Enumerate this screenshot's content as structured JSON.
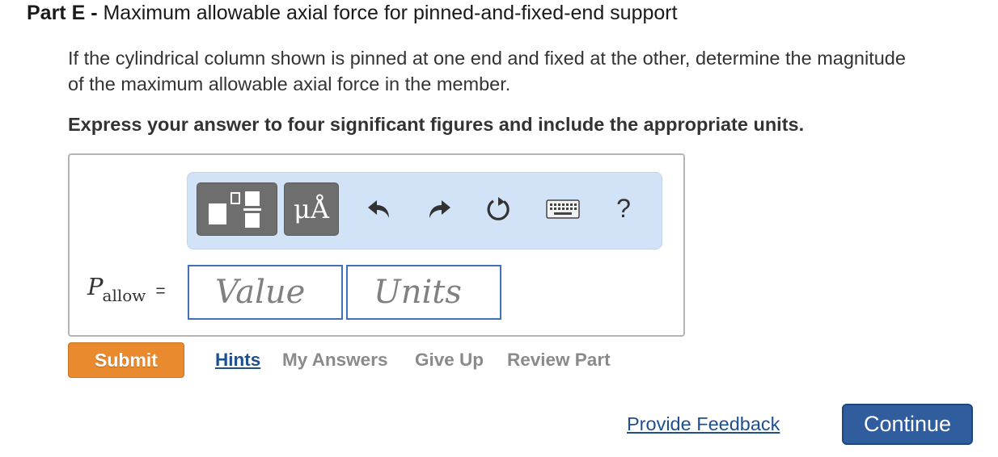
{
  "part": {
    "label": "Part E -",
    "title": "Maximum allowable axial force for pinned-and-fixed-end support"
  },
  "question": {
    "text": "If the cylindrical column shown is pinned at one end and fixed at the other, determine the magnitude of the maximum allowable axial force in the member.",
    "instruction": "Express your answer to four significant figures and include the appropriate units."
  },
  "toolbar": {
    "templates_icon": "templates-icon",
    "units_label": "μÅ",
    "undo_icon": "undo-icon",
    "redo_icon": "redo-icon",
    "reset_icon": "reset-icon",
    "keyboard_icon": "keyboard-icon",
    "help_label": "?"
  },
  "answer": {
    "variable": "P",
    "subscript": "allow",
    "equals": "=",
    "value_placeholder": "Value",
    "units_placeholder": "Units"
  },
  "actions": {
    "submit": "Submit",
    "hints": "Hints",
    "my_answers": "My Answers",
    "give_up": "Give Up",
    "review_part": "Review Part"
  },
  "footer": {
    "feedback": "Provide Feedback",
    "continue": "Continue"
  },
  "colors": {
    "submit_bg": "#ea8a2e",
    "continue_bg": "#2f5d9e",
    "link": "#1d4f91",
    "toolbar_bg": "#d2e3f7",
    "input_border": "#3f72b8"
  }
}
